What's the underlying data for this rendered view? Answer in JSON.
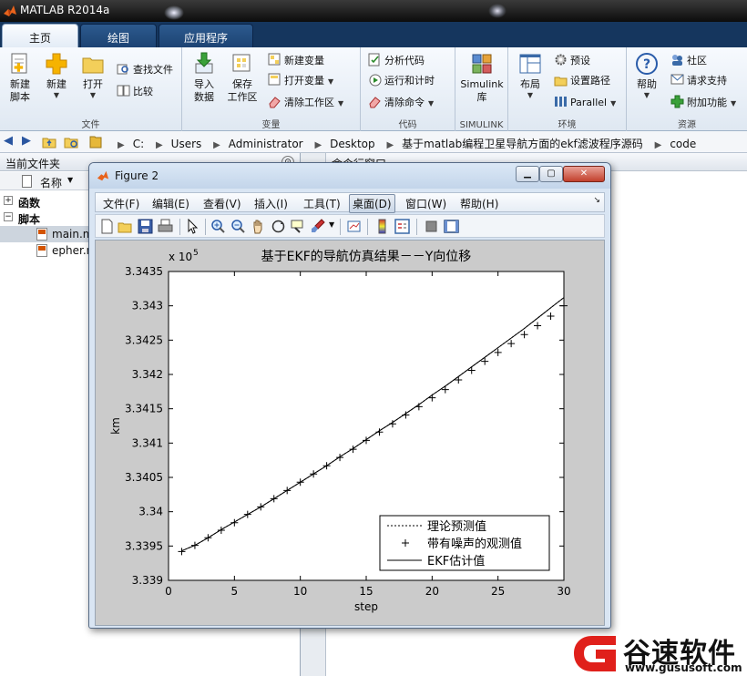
{
  "window": {
    "title": "MATLAB R2014a"
  },
  "tabs": [
    {
      "label": "主页",
      "active": true
    },
    {
      "label": "绘图",
      "active": false
    },
    {
      "label": "应用程序",
      "active": false
    }
  ],
  "ribbon": {
    "file": {
      "group_name": "文件",
      "new_script": "新建\n脚本",
      "new": "新建",
      "open": "打开",
      "find_files": "查找文件",
      "compare": "比较"
    },
    "variable": {
      "group_name": "变量",
      "import_data": "导入\n数据",
      "save_workspace": "保存\n工作区",
      "new_variable": "新建变量",
      "open_variable": "打开变量",
      "clear_workspace": "清除工作区"
    },
    "code": {
      "group_name": "代码",
      "analyze_code": "分析代码",
      "run_and_time": "运行和计时",
      "clear_commands": "清除命令"
    },
    "simulink": {
      "group_name": "SIMULINK",
      "library_line1": "Simulink",
      "library_line2": "库"
    },
    "environment": {
      "group_name": "环境",
      "layout": "布局",
      "preferences": "预设",
      "set_path": "设置路径",
      "parallel": "Parallel"
    },
    "resources": {
      "group_name": "资源",
      "help": "帮助",
      "community": "社区",
      "request_support": "请求支持",
      "add_ons": "附加功能"
    }
  },
  "address": {
    "crumbs": [
      "C:",
      "Users",
      "Administrator",
      "Desktop",
      "基于matlab编程卫星导航方面的ekf滤波程序源码",
      "code"
    ]
  },
  "current_folder": {
    "title": "当前文件夹",
    "column_name": "名称",
    "sections": [
      {
        "label": "函数",
        "expander": "+"
      },
      {
        "label": "脚本",
        "expander": "−"
      }
    ],
    "files": [
      "main.m",
      "epher.m"
    ]
  },
  "command_window": {
    "title": "命令行窗口"
  },
  "figure": {
    "title": "Figure 2",
    "menu": [
      "文件(F)",
      "编辑(E)",
      "查看(V)",
      "插入(I)",
      "工具(T)",
      "桌面(D)",
      "窗口(W)",
      "帮助(H)"
    ],
    "active_menu_index": 5,
    "toolbar_icons": [
      "new-figure-icon",
      "open-file-icon",
      "save-icon",
      "print-icon",
      "edit-plot-arrow-icon",
      "zoom-in-icon",
      "zoom-out-icon",
      "pan-hand-icon",
      "rotate-3d-icon",
      "data-cursor-icon",
      "brush-icon",
      "link-plot-icon",
      "insert-colorbar-icon",
      "insert-legend-icon",
      "hide-plot-tools-icon",
      "show-plot-tools-icon"
    ]
  },
  "chart_data": {
    "type": "line",
    "title": "基于EKF的导航仿真结果－－Y向位移",
    "xlabel": "step",
    "ylabel": "km",
    "multiplier_label": "x 10",
    "multiplier_exponent": "5",
    "xlim": [
      0,
      30
    ],
    "ylim": [
      3.339,
      3.3435
    ],
    "xticks": [
      0,
      5,
      10,
      15,
      20,
      25,
      30
    ],
    "yticks": [
      3.339,
      3.3395,
      3.34,
      3.3405,
      3.341,
      3.3415,
      3.342,
      3.3425,
      3.343,
      3.3435
    ],
    "ytick_labels": [
      "3.339",
      "3.3395",
      "3.34",
      "3.3405",
      "3.341",
      "3.3415",
      "3.342",
      "3.3425",
      "3.343",
      "3.3435"
    ],
    "grid": false,
    "legend_position": "bottom-right",
    "x": [
      1,
      2,
      3,
      4,
      5,
      6,
      7,
      8,
      9,
      10,
      11,
      12,
      13,
      14,
      15,
      16,
      17,
      18,
      19,
      20,
      21,
      22,
      23,
      24,
      25,
      26,
      27,
      28,
      29,
      30
    ],
    "series": [
      {
        "name": "理论预测值",
        "style": "dotted",
        "values": [
          3.33943,
          3.33951,
          3.33962,
          3.33974,
          3.33985,
          3.33996,
          3.34007,
          3.34019,
          3.34031,
          3.34043,
          3.34055,
          3.34067,
          3.3408,
          3.34092,
          3.34105,
          3.34118,
          3.3413,
          3.34143,
          3.34156,
          3.3417,
          3.34183,
          3.34197,
          3.34211,
          3.34225,
          3.34239,
          3.34253,
          3.34267,
          3.34282,
          3.34297,
          3.34312
        ]
      },
      {
        "name": "带有噪声的观测值",
        "style": "plus-markers",
        "values": [
          3.33942,
          3.33951,
          3.33962,
          3.33973,
          3.33984,
          3.33996,
          3.34007,
          3.34019,
          3.34031,
          3.34043,
          3.34055,
          3.34067,
          3.34079,
          3.34091,
          3.34104,
          3.34116,
          3.34128,
          3.34141,
          3.34153,
          3.34166,
          3.34178,
          3.34192,
          3.34206,
          3.34219,
          3.34232,
          3.34245,
          3.34258,
          3.34271,
          3.34285,
          3.343
        ]
      },
      {
        "name": "EKF估计值",
        "style": "solid",
        "values": [
          3.33943,
          3.33951,
          3.33962,
          3.33974,
          3.33985,
          3.33996,
          3.34007,
          3.34019,
          3.34031,
          3.34043,
          3.34055,
          3.34067,
          3.3408,
          3.34092,
          3.34105,
          3.34118,
          3.3413,
          3.34143,
          3.34156,
          3.3417,
          3.34183,
          3.34197,
          3.34211,
          3.34225,
          3.34239,
          3.34253,
          3.34267,
          3.34282,
          3.34297,
          3.34312
        ]
      }
    ]
  },
  "watermark": {
    "name": "谷速软件",
    "url": "www.gususoft.com",
    "logo_color": "#e0201b"
  }
}
